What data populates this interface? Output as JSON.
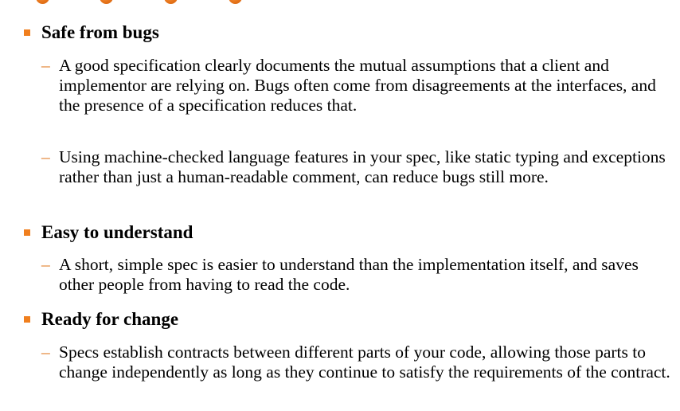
{
  "sections": [
    {
      "title": "Safe from bugs",
      "items": [
        "A good specification clearly documents the mutual assumptions that a client and implementor are relying on. Bugs often come from disagreements at the interfaces, and the presence of a specification reduces that.",
        "Using machine-checked language features in your spec, like static typing and exceptions rather than just a human-readable comment, can reduce bugs still more."
      ]
    },
    {
      "title": "Easy to understand",
      "items": [
        "A short, simple spec is easier to understand than the implementation itself, and saves other people from having to read the code."
      ]
    },
    {
      "title": "Ready for change",
      "items": [
        "Specs establish contracts between different parts of your code, allowing those parts to change independently as long as they continue to satisfy the requirements of the contract."
      ]
    }
  ],
  "bullet_marker": "–",
  "colors": {
    "accent": "#f07f1e",
    "dash": "#e07a22",
    "text": "#000000"
  }
}
